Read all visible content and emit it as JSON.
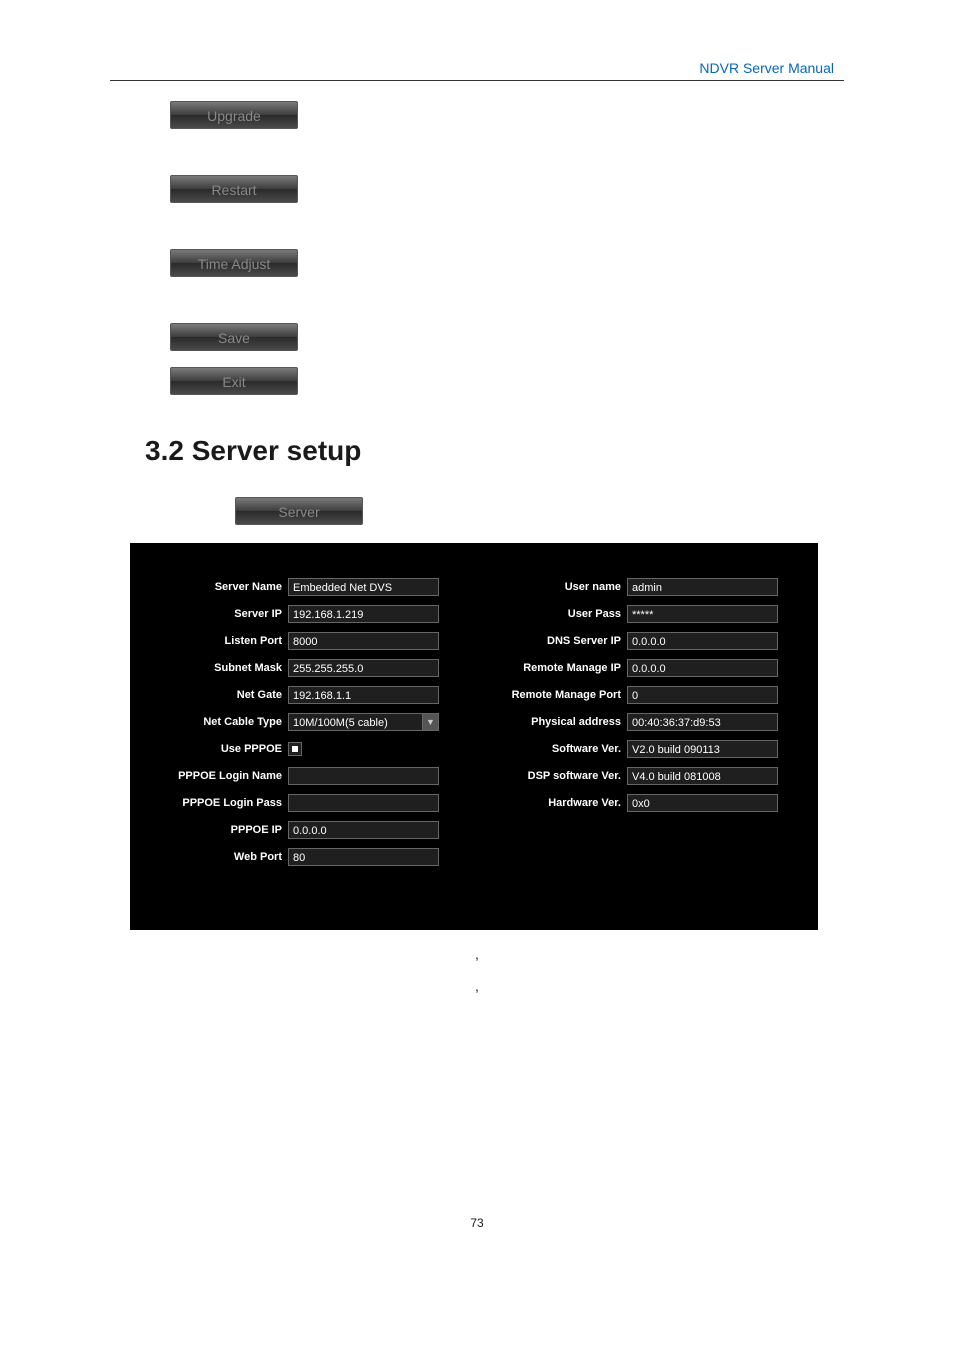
{
  "header": {
    "title": "NDVR Server Manual"
  },
  "buttons": {
    "upgrade": "Upgrade",
    "restart": "Restart",
    "time_adjust": "Time Adjust",
    "save": "Save",
    "exit": "Exit",
    "server": "Server"
  },
  "section": {
    "title": "3.2 Server setup"
  },
  "panel": {
    "left": {
      "server_name": {
        "label": "Server Name",
        "value": "Embedded Net DVS"
      },
      "server_ip": {
        "label": "Server IP",
        "value": "192.168.1.219"
      },
      "listen_port": {
        "label": "Listen Port",
        "value": "8000"
      },
      "subnet_mask": {
        "label": "Subnet Mask",
        "value": "255.255.255.0"
      },
      "net_gate": {
        "label": "Net Gate",
        "value": "192.168.1.1"
      },
      "net_cable_type": {
        "label": "Net Cable Type",
        "value": "10M/100M(5 cable)"
      },
      "use_pppoe": {
        "label": "Use PPPOE"
      },
      "pppoe_login_name": {
        "label": "PPPOE Login Name",
        "value": ""
      },
      "pppoe_login_pass": {
        "label": "PPPOE Login Pass",
        "value": ""
      },
      "pppoe_ip": {
        "label": "PPPOE IP",
        "value": "0.0.0.0"
      },
      "web_port": {
        "label": "Web Port",
        "value": "80"
      }
    },
    "right": {
      "user_name": {
        "label": "User name",
        "value": "admin"
      },
      "user_pass": {
        "label": "User Pass",
        "value": "*****"
      },
      "dns_server_ip": {
        "label": "DNS Server IP",
        "value": "0.0.0.0"
      },
      "remote_manage_ip": {
        "label": "Remote Manage IP",
        "value": "0.0.0.0"
      },
      "remote_manage_port": {
        "label": "Remote Manage Port",
        "value": "0"
      },
      "physical_address": {
        "label": "Physical address",
        "value": "00:40:36:37:d9:53"
      },
      "software_ver": {
        "label": "Software Ver.",
        "value": "V2.0 build 090113"
      },
      "dsp_software_ver": {
        "label": "DSP software Ver.",
        "value": "V4.0 build 081008"
      },
      "hardware_ver": {
        "label": "Hardware Ver.",
        "value": "0x0"
      }
    }
  },
  "captions": {
    "line1": ",",
    "line2": ","
  },
  "footer": {
    "page": "73"
  }
}
